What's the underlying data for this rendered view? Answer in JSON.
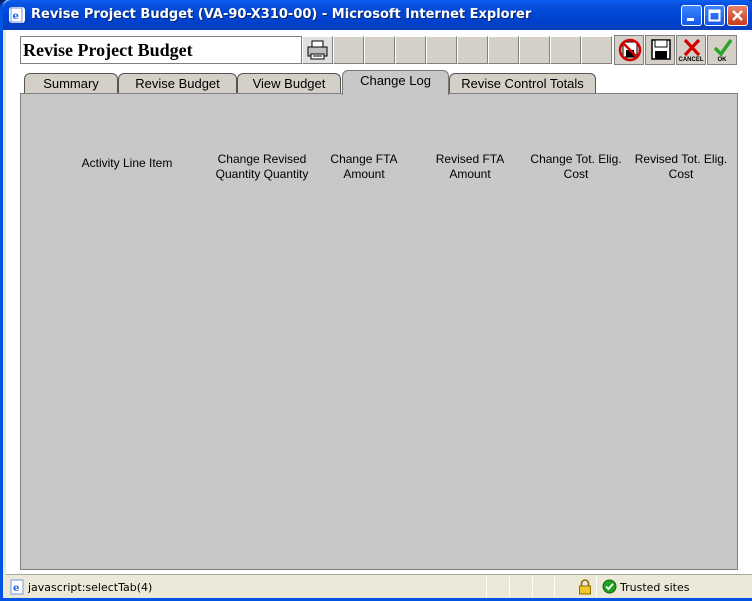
{
  "window": {
    "title": "Revise Project Budget (VA-90-X310-00) - Microsoft Internet Explorer"
  },
  "toolbar": {
    "page_title": "Revise Project Budget",
    "cancel_label": "CANCEL",
    "ok_label": "OK"
  },
  "tabs": [
    {
      "label": "Summary",
      "active": false
    },
    {
      "label": "Revise Budget",
      "active": false
    },
    {
      "label": "View Budget",
      "active": false
    },
    {
      "label": "Change Log",
      "active": true
    },
    {
      "label": "Revise Control Totals",
      "active": false
    }
  ],
  "change_log": {
    "columns": [
      {
        "line1": "Activity Line Item",
        "line2": ""
      },
      {
        "line1": "Change Revised",
        "line2": "Quantity Quantity"
      },
      {
        "line1": "Change FTA",
        "line2": "Amount"
      },
      {
        "line1": "Revised FTA",
        "line2": "Amount"
      },
      {
        "line1": "Change Tot. Elig.",
        "line2": "Cost"
      },
      {
        "line1": "Revised Tot. Elig.",
        "line2": "Cost"
      }
    ]
  },
  "statusbar": {
    "text": "javascript:selectTab(4)",
    "zone": "Trusted sites"
  },
  "colors": {
    "titlebar": "#0046d6",
    "content_bg": "#c8c8c8",
    "cancel_red": "#d40000",
    "ok_green": "#2aa52a"
  }
}
